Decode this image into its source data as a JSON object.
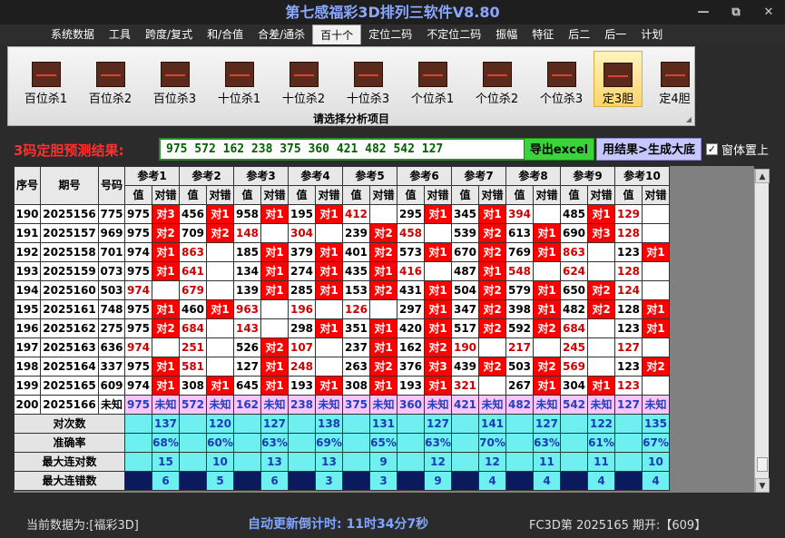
{
  "window": {
    "title": "第七感福彩3D排列三软件V8.80",
    "min": "—",
    "restore": "⧉",
    "close": "✕"
  },
  "menu": [
    "系统数据",
    "工具",
    "跨度/复式",
    "和/合值",
    "合差/通杀",
    "百十个",
    "定位二码",
    "不定位二码",
    "振幅",
    "特征",
    "后二",
    "后一",
    "计划"
  ],
  "menu_active": 5,
  "ribbon": {
    "buttons": [
      "百位杀1",
      "百位杀2",
      "百位杀3",
      "十位杀1",
      "十位杀2",
      "十位杀3",
      "个位杀1",
      "个位杀2",
      "个位杀3",
      "定3胆",
      "定4胆"
    ],
    "selected": 9,
    "caption": "请选择分析项目",
    "corner": "◢"
  },
  "result": {
    "label": "3码定胆预测结果:",
    "value": "975 572 162 238 375 360 421 482 542 127",
    "export_label": "导出excel",
    "generate_label": "用结果>生成大底",
    "checkbox_mark": "✓",
    "checkbox_label": "窗体置上"
  },
  "table": {
    "headers": {
      "seq": "序号",
      "period": "期号",
      "code": "号码",
      "val": "值",
      "res": "对错"
    },
    "refs": [
      "参考1",
      "参考2",
      "参考3",
      "参考4",
      "参考5",
      "参考6",
      "参考7",
      "参考8",
      "参考9",
      "参考10"
    ],
    "rows": [
      {
        "seq": "190",
        "period": "2025156",
        "code": "775",
        "cells": [
          [
            "975",
            "对3"
          ],
          [
            "456",
            "对1"
          ],
          [
            "958",
            "对1"
          ],
          [
            "195",
            "对1"
          ],
          [
            "412",
            ""
          ],
          [
            "295",
            "对1"
          ],
          [
            "345",
            "对1"
          ],
          [
            "394",
            ""
          ],
          [
            "485",
            "对1"
          ],
          [
            "129",
            ""
          ]
        ]
      },
      {
        "seq": "191",
        "period": "2025157",
        "code": "969",
        "cells": [
          [
            "975",
            "对2"
          ],
          [
            "709",
            "对2"
          ],
          [
            "148",
            ""
          ],
          [
            "304",
            ""
          ],
          [
            "239",
            "对2"
          ],
          [
            "458",
            ""
          ],
          [
            "539",
            "对2"
          ],
          [
            "613",
            "对1"
          ],
          [
            "690",
            "对3"
          ],
          [
            "128",
            ""
          ]
        ]
      },
      {
        "seq": "192",
        "period": "2025158",
        "code": "701",
        "cells": [
          [
            "974",
            "对1"
          ],
          [
            "863",
            ""
          ],
          [
            "185",
            "对1"
          ],
          [
            "379",
            "对1"
          ],
          [
            "401",
            "对2"
          ],
          [
            "573",
            "对1"
          ],
          [
            "670",
            "对2"
          ],
          [
            "769",
            "对1"
          ],
          [
            "863",
            ""
          ],
          [
            "123",
            "对1"
          ]
        ]
      },
      {
        "seq": "193",
        "period": "2025159",
        "code": "073",
        "cells": [
          [
            "975",
            "对1"
          ],
          [
            "641",
            ""
          ],
          [
            "134",
            "对1"
          ],
          [
            "274",
            "对1"
          ],
          [
            "435",
            "对1"
          ],
          [
            "416",
            ""
          ],
          [
            "487",
            "对1"
          ],
          [
            "548",
            ""
          ],
          [
            "624",
            ""
          ],
          [
            "128",
            ""
          ]
        ]
      },
      {
        "seq": "194",
        "period": "2025160",
        "code": "503",
        "cells": [
          [
            "974",
            ""
          ],
          [
            "679",
            ""
          ],
          [
            "139",
            "对1"
          ],
          [
            "285",
            "对1"
          ],
          [
            "153",
            "对2"
          ],
          [
            "431",
            "对1"
          ],
          [
            "504",
            "对2"
          ],
          [
            "579",
            "对1"
          ],
          [
            "650",
            "对2"
          ],
          [
            "124",
            ""
          ]
        ]
      },
      {
        "seq": "195",
        "period": "2025161",
        "code": "748",
        "cells": [
          [
            "975",
            "对1"
          ],
          [
            "460",
            "对1"
          ],
          [
            "963",
            ""
          ],
          [
            "196",
            ""
          ],
          [
            "126",
            ""
          ],
          [
            "297",
            "对1"
          ],
          [
            "347",
            "对2"
          ],
          [
            "398",
            "对1"
          ],
          [
            "482",
            "对2"
          ],
          [
            "128",
            "对1"
          ]
        ]
      },
      {
        "seq": "196",
        "period": "2025162",
        "code": "275",
        "cells": [
          [
            "975",
            "对2"
          ],
          [
            "684",
            ""
          ],
          [
            "143",
            ""
          ],
          [
            "298",
            "对1"
          ],
          [
            "351",
            "对1"
          ],
          [
            "420",
            "对1"
          ],
          [
            "517",
            "对2"
          ],
          [
            "592",
            "对2"
          ],
          [
            "684",
            ""
          ],
          [
            "123",
            "对1"
          ]
        ]
      },
      {
        "seq": "197",
        "period": "2025163",
        "code": "636",
        "cells": [
          [
            "974",
            ""
          ],
          [
            "251",
            ""
          ],
          [
            "526",
            "对2"
          ],
          [
            "107",
            ""
          ],
          [
            "237",
            "对1"
          ],
          [
            "162",
            "对2"
          ],
          [
            "190",
            ""
          ],
          [
            "217",
            ""
          ],
          [
            "245",
            ""
          ],
          [
            "127",
            ""
          ]
        ]
      },
      {
        "seq": "198",
        "period": "2025164",
        "code": "337",
        "cells": [
          [
            "975",
            "对1"
          ],
          [
            "581",
            ""
          ],
          [
            "127",
            "对1"
          ],
          [
            "248",
            ""
          ],
          [
            "263",
            "对2"
          ],
          [
            "376",
            "对3"
          ],
          [
            "439",
            "对2"
          ],
          [
            "503",
            "对2"
          ],
          [
            "569",
            ""
          ],
          [
            "123",
            "对2"
          ]
        ]
      },
      {
        "seq": "199",
        "period": "2025165",
        "code": "609",
        "cells": [
          [
            "974",
            "对1"
          ],
          [
            "308",
            "对1"
          ],
          [
            "645",
            "对1"
          ],
          [
            "193",
            "对1"
          ],
          [
            "308",
            "对1"
          ],
          [
            "193",
            "对1"
          ],
          [
            "321",
            ""
          ],
          [
            "267",
            "对1"
          ],
          [
            "304",
            "对1"
          ],
          [
            "123",
            ""
          ]
        ]
      }
    ],
    "predict": {
      "seq": "200",
      "period": "2025166",
      "code": "未知",
      "status": "未知",
      "vals": [
        "975",
        "572",
        "162",
        "238",
        "375",
        "360",
        "421",
        "482",
        "542",
        "127"
      ]
    },
    "stats": [
      {
        "label": "对次数",
        "vals": [
          "137",
          "120",
          "127",
          "138",
          "131",
          "127",
          "141",
          "127",
          "122",
          "135"
        ]
      },
      {
        "label": "准确率",
        "vals": [
          "68%",
          "60%",
          "63%",
          "69%",
          "65%",
          "63%",
          "70%",
          "63%",
          "61%",
          "67%"
        ]
      },
      {
        "label": "最大连对数",
        "vals": [
          "15",
          "10",
          "13",
          "13",
          "9",
          "12",
          "12",
          "11",
          "11",
          "10"
        ]
      },
      {
        "label": "最大连错数",
        "vals": [
          "6",
          "5",
          "6",
          "3",
          "3",
          "9",
          "4",
          "4",
          "4",
          "4"
        ]
      }
    ]
  },
  "scroll": {
    "up": "▲",
    "down": "▼"
  },
  "status": {
    "data_source": "当前数据为:[福彩3D]",
    "countdown": "自动更新倒计时:  11时34分7秒",
    "latest": "FC3D第 2025165 期开:【609】"
  }
}
